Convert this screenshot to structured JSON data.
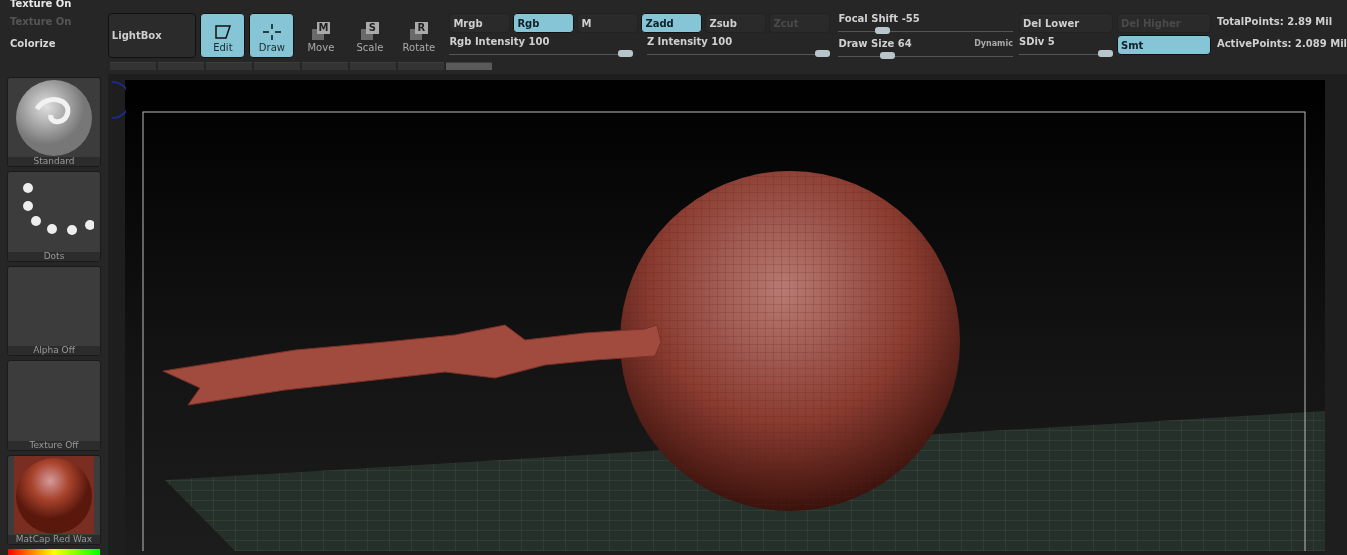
{
  "header": {
    "title": "Texture On"
  },
  "texture_panel": [
    {
      "label": "Texture On",
      "disabled": true
    },
    {
      "label": "Colorize",
      "disabled": false
    }
  ],
  "lightbox": {
    "label": "LightBox"
  },
  "tools": [
    {
      "kind": "edit",
      "label": "Edit",
      "selected": true
    },
    {
      "kind": "draw",
      "label": "Draw",
      "selected": true
    },
    {
      "kind": "move",
      "label": "Move",
      "key": "M",
      "selected": false
    },
    {
      "kind": "scale",
      "label": "Scale",
      "key": "S",
      "selected": false
    },
    {
      "kind": "rotate",
      "label": "Rotate",
      "key": "R",
      "selected": false
    }
  ],
  "mode_buttons": [
    {
      "label": "Mrgb",
      "selected": false,
      "disabled": false
    },
    {
      "label": "Rgb",
      "selected": true,
      "disabled": false
    },
    {
      "label": "M",
      "selected": false,
      "disabled": false
    },
    {
      "label": "Zadd",
      "selected": true,
      "disabled": false
    },
    {
      "label": "Zsub",
      "selected": false,
      "disabled": false
    },
    {
      "label": "Zcut",
      "selected": false,
      "disabled": true
    }
  ],
  "intensity_sliders": [
    {
      "label": "Rgb Intensity 100",
      "level": 1
    },
    {
      "label": "Z Intensity 100",
      "level": 1
    }
  ],
  "brush_sliders": [
    {
      "label": "Focal Shift -55",
      "level": 0.23
    },
    {
      "label": "Draw Size 64",
      "level": 0.26,
      "tag": "Dynamic"
    }
  ],
  "geometry": {
    "buttons": [
      {
        "label": "Del Lower",
        "disabled": false
      },
      {
        "label": "Del Higher",
        "disabled": true
      }
    ],
    "sdiv": {
      "label": "SDiv 5",
      "level": 1
    },
    "smooth": {
      "label": "Smt",
      "selected": true
    }
  },
  "stats": [
    "TotalPoints: 2.89 Mil",
    "ActivePoints: 2.089 Mil"
  ],
  "shelf": [
    {
      "kind": "brush",
      "label": "Standard"
    },
    {
      "kind": "stroke",
      "label": "Dots"
    },
    {
      "kind": "empty",
      "label": "Alpha Off"
    },
    {
      "kind": "empty",
      "label": "Texture Off"
    },
    {
      "kind": "material",
      "label": "MatCap Red Wax"
    }
  ]
}
